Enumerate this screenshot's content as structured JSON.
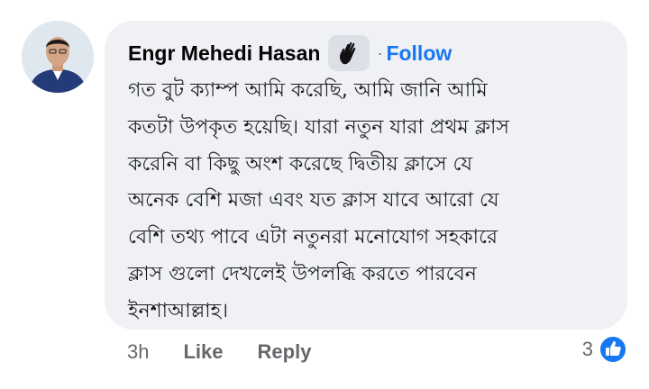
{
  "comment": {
    "author": "Engr Mehedi Hasan",
    "badge_icon": "waving-hand-icon",
    "separator": "·",
    "follow_label": "Follow",
    "lines": [
      "গত বুট ক্যাম্প আমি করেছি, আমি জানি আমি",
      "কতটা উপকৃত হয়েছি। যারা নতুন যারা প্রথম ক্লাস",
      "করেনি বা কিছু অংশ করেছে দ্বিতীয় ক্লাসে যে",
      "অনেক বেশি মজা এবং যত ক্লাস যাবে আরো যে",
      "বেশি তথ্য পাবে এটা নতুনরা মনোযোগ সহকারে",
      "ক্লাস গুলো দেখলেই উপলব্ধি করতে পারবেন",
      "ইনশাআল্লাহ।"
    ]
  },
  "actions": {
    "time": "3h",
    "like_label": "Like",
    "reply_label": "Reply"
  },
  "reactions": {
    "count": "3",
    "icon": "like-thumbs-up-icon",
    "color": "#1877f2"
  }
}
